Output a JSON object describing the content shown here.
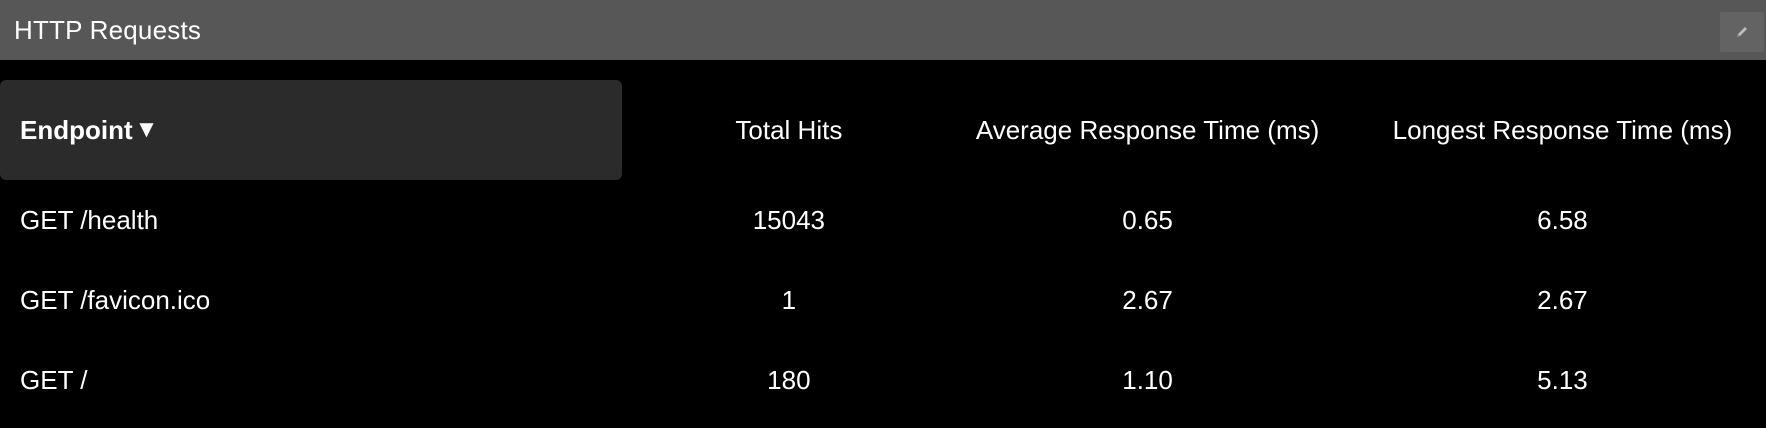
{
  "panel": {
    "title": "HTTP Requests",
    "edit_icon": "pencil-icon"
  },
  "table": {
    "columns": {
      "endpoint": "Endpoint",
      "sort_indicator": "▼",
      "total_hits": "Total Hits",
      "avg_response": "Average Response Time (ms)",
      "longest_response": "Longest Response Time (ms)"
    },
    "rows": [
      {
        "endpoint": "GET /health",
        "hits": "15043",
        "avg": "0.65",
        "longest": "6.58"
      },
      {
        "endpoint": "GET /favicon.ico",
        "hits": "1",
        "avg": "2.67",
        "longest": "2.67"
      },
      {
        "endpoint": "GET /",
        "hits": "180",
        "avg": "1.10",
        "longest": "5.13"
      }
    ]
  }
}
